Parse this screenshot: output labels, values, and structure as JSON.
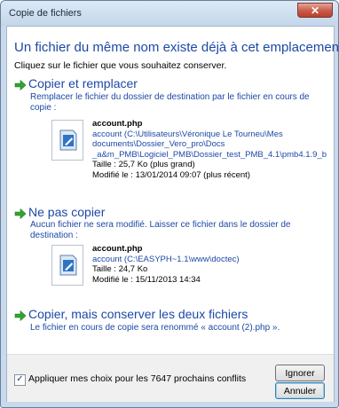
{
  "window": {
    "title": "Copie de fichiers",
    "close_glyph": "✕"
  },
  "header": {
    "title": "Un fichier du même nom existe déjà à cet emplacement.",
    "subtitle": "Cliquez sur le fichier que vous souhaitez conserver."
  },
  "options": [
    {
      "title": "Copier et remplacer",
      "description": "Remplacer le fichier du dossier de destination par le fichier en cours de copie :",
      "file": {
        "name": "account.php",
        "path_lines": [
          "account (C:\\Utilisateurs\\Véronique Le Tourneu\\Mes",
          "documents\\Dossier_Vero_pro\\Docs",
          "_a&m_PMB\\Logiciel_PMB\\Dossier_test_PMB_4.1\\pmb4.1.9_b"
        ],
        "size": "Taille : 25,7 Ko (plus grand)",
        "modified": "Modifié le : 13/01/2014 09:07 (plus récent)"
      }
    },
    {
      "title": "Ne pas copier",
      "description": "Aucun fichier ne sera modifié. Laisser ce fichier dans le dossier de destination :",
      "file": {
        "name": "account.php",
        "path_lines": [
          "account (C:\\EASYPH~1.1\\www\\doctec)"
        ],
        "size": "Taille : 24,7 Ko",
        "modified": "Modifié le : 15/11/2013 14:34"
      }
    },
    {
      "title": "Copier, mais conserver les deux fichiers",
      "description": "Le fichier en cours de copie sera renommé « account (2).php »."
    }
  ],
  "footer": {
    "checkbox_label": "Appliquer mes choix pour les 7647 prochains conflits",
    "checked": true,
    "ignore_label": "Ignorer",
    "cancel_label": "Annuler"
  },
  "colors": {
    "link_blue": "#1c49a6",
    "arrow_green": "#2fa52f",
    "frame": "#c9daed"
  },
  "icons": [
    "close-icon",
    "green-arrow-icon",
    "php-file-icon",
    "checkmark-icon"
  ]
}
